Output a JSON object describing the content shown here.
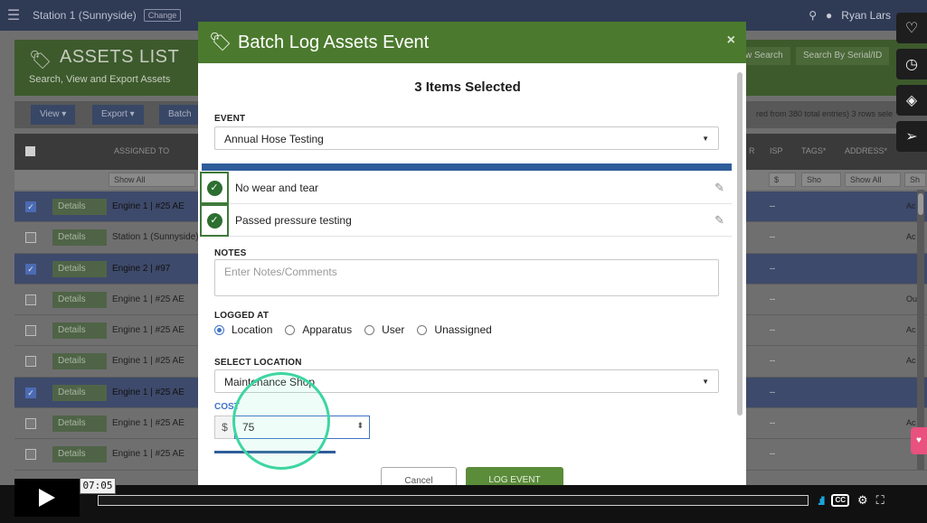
{
  "app": {
    "station": "Station 1 (Sunnyside)",
    "change_label": "Change",
    "user_name": "Ryan Lars",
    "page_title": "ASSETS LIST",
    "page_subtitle": "Search, View and Export Assets",
    "search_btn_1": "w Search",
    "search_btn_2": "Search By Serial/ID",
    "toolbar": {
      "view": "View ▾",
      "export": "Export ▾",
      "batch": "Batch"
    },
    "table_info": "red from 380 total entries)   3 rows sele",
    "columns": {
      "assigned_to": "ASSIGNED TO",
      "r": "R",
      "isp": "ISP",
      "tags": "TAGS*",
      "address": "ADDRESS*"
    },
    "filters": {
      "assigned": "Show All",
      "s": "$",
      "sho": "Sho",
      "address": "Show All",
      "last": "Sh"
    },
    "details_label": "Details",
    "dash": "--",
    "rows": [
      {
        "assigned": "Engine 1 | #25 AE",
        "last": "Ac"
      },
      {
        "assigned": "Station 1 (Sunnyside)",
        "last": "Ac"
      },
      {
        "assigned": "Engine 2 | #97",
        "last": ""
      },
      {
        "assigned": "Engine 1 | #25 AE",
        "last": "Ou"
      },
      {
        "assigned": "Engine 1 | #25 AE",
        "last": "Ac"
      },
      {
        "assigned": "Engine 1 | #25 AE",
        "last": "Ac"
      },
      {
        "assigned": "Engine 1 | #25 AE",
        "last": ""
      },
      {
        "assigned": "Engine 1 | #25 AE",
        "last": "Ac"
      },
      {
        "assigned": "Engine 1 | #25 AE",
        "last": ""
      }
    ]
  },
  "modal": {
    "title": "Batch Log Assets Event",
    "close": "×",
    "selected_count": "3 Items Selected",
    "event_label": "EVENT",
    "event_value": "Annual Hose Testing",
    "checks": [
      "No wear and tear",
      "Passed pressure testing"
    ],
    "notes_label": "NOTES",
    "notes_placeholder": "Enter Notes/Comments",
    "logged_at_label": "LOGGED AT",
    "logged_at_options": [
      "Location",
      "Apparatus",
      "User",
      "Unassigned"
    ],
    "logged_at_selected": "Location",
    "location_label": "SELECT LOCATION",
    "location_value": "Maintenance Shop",
    "cost_label": "COST",
    "cost_prefix": "$",
    "cost_value": "75",
    "cancel_label": "Cancel",
    "log_label": "LOG EVENT"
  },
  "player": {
    "timecode": "07:05",
    "progress_fraction": 0.0
  },
  "colors": {
    "modal_header": "#4b7a2e",
    "accent_blue": "#3f74c7",
    "log_button": "#5b8c3a",
    "ring": "#3dd6a0"
  }
}
